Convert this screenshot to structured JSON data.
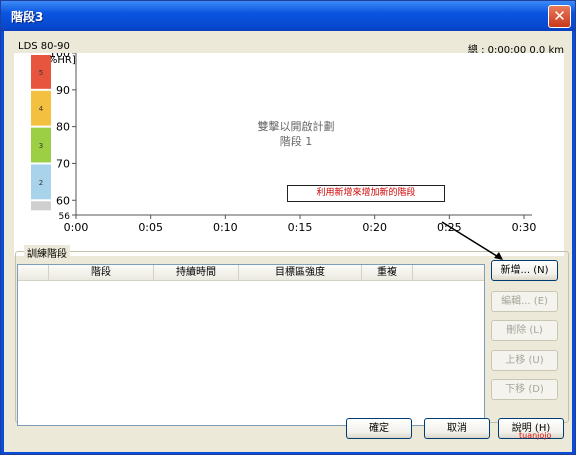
{
  "window": {
    "title": "階段3"
  },
  "header": {
    "workout_name": "LDS 80-90",
    "total": "總 : 0:00:00   0.0 km"
  },
  "chart_data": {
    "type": "area",
    "ylabel": "[%HR]",
    "ylim": [
      56,
      100
    ],
    "y_ticks": [
      "100",
      "90",
      "80",
      "70",
      "60",
      "56"
    ],
    "x_ticks": [
      "0:00",
      "0:05",
      "0:10",
      "0:15",
      "0:20",
      "0:25",
      "0:30"
    ],
    "zones": [
      {
        "label": "5",
        "color": "#e8553e"
      },
      {
        "label": "4",
        "color": "#f4c040"
      },
      {
        "label": "3",
        "color": "#9ccf43"
      },
      {
        "label": "2",
        "color": "#a9d3ea"
      },
      {
        "label": "",
        "color": "#cfcfcf"
      }
    ],
    "series": [],
    "placeholder_line1": "雙擊以開啟計劃",
    "placeholder_line2": "階段 1"
  },
  "callout": {
    "text": "利用新增來增加新的階段"
  },
  "steps": {
    "group_label": "訓練階段",
    "columns": [
      "階段",
      "持續時間",
      "目標區強度",
      "重複"
    ],
    "rows": []
  },
  "buttons": {
    "add": "新增... (N)",
    "edit": "編輯... (E)",
    "delete": "刪除 (L)",
    "up": "上移 (U)",
    "down": "下移 (D)",
    "ok": "確定",
    "cancel": "取消",
    "help": "說明 (H)"
  },
  "signature": "tuanjojo",
  "colors": {
    "titlebar": "#0a55e0",
    "callout_text": "#d00000",
    "chart_axis": "#555555"
  }
}
